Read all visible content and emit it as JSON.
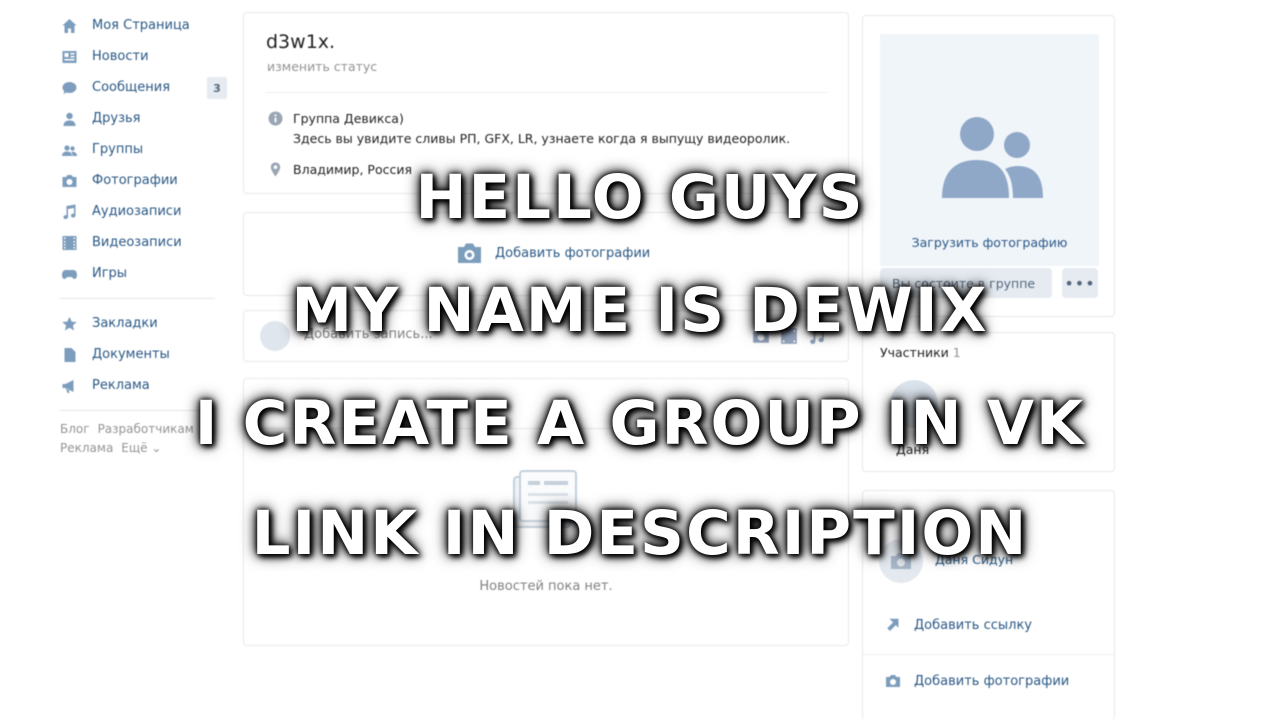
{
  "nav": {
    "items": [
      {
        "label": "Моя Страница",
        "icon": "home-icon"
      },
      {
        "label": "Новости",
        "icon": "news-icon"
      },
      {
        "label": "Сообщения",
        "icon": "messages-icon",
        "badge": "3"
      },
      {
        "label": "Друзья",
        "icon": "friends-icon"
      },
      {
        "label": "Группы",
        "icon": "groups-icon"
      },
      {
        "label": "Фотографии",
        "icon": "photos-icon"
      },
      {
        "label": "Аудиозаписи",
        "icon": "audio-icon"
      },
      {
        "label": "Видеозаписи",
        "icon": "video-icon"
      },
      {
        "label": "Игры",
        "icon": "games-icon"
      }
    ],
    "secondary": [
      {
        "label": "Закладки",
        "icon": "bookmarks-icon"
      },
      {
        "label": "Документы",
        "icon": "documents-icon"
      },
      {
        "label": "Реклама",
        "icon": "ads-icon"
      }
    ],
    "footer": [
      "Блог",
      "Разработчикам",
      "Реклама",
      "Ещё ⌄"
    ]
  },
  "profile": {
    "name": "d3w1x.",
    "status": "изменить статус",
    "about_title": "Группа Девикса)",
    "about_text": "Здесь вы увидите сливы РП, GFX, LR, узнаете когда я выпущу видеоролик.",
    "location": "Владимир, Россия"
  },
  "add_photos": {
    "label": "Добавить фотографии"
  },
  "composer": {
    "placeholder": "Добавить запись..."
  },
  "feed": {
    "empty": "Новостей пока нет."
  },
  "photo_card": {
    "upload_label": "Загрузить фотографию",
    "send_label": "Вы состоите в группе",
    "more_label": "•••"
  },
  "members": {
    "title": "Участники",
    "count": "1",
    "name": "Даня"
  },
  "links": {
    "contact_name": "Даня Сидун",
    "add_link": "Добавить ссылку",
    "add_photos": "Добавить фотографии"
  },
  "overlay": {
    "lines": [
      "HELLO GUYS",
      "MY NAME IS DEWIX",
      "I CREATE A GROUP IN VK",
      "LINK IN DESCRIPTION"
    ]
  },
  "colors": {
    "link": "#2a5885",
    "icon": "#7d9dbd",
    "background": "#ffffff"
  }
}
